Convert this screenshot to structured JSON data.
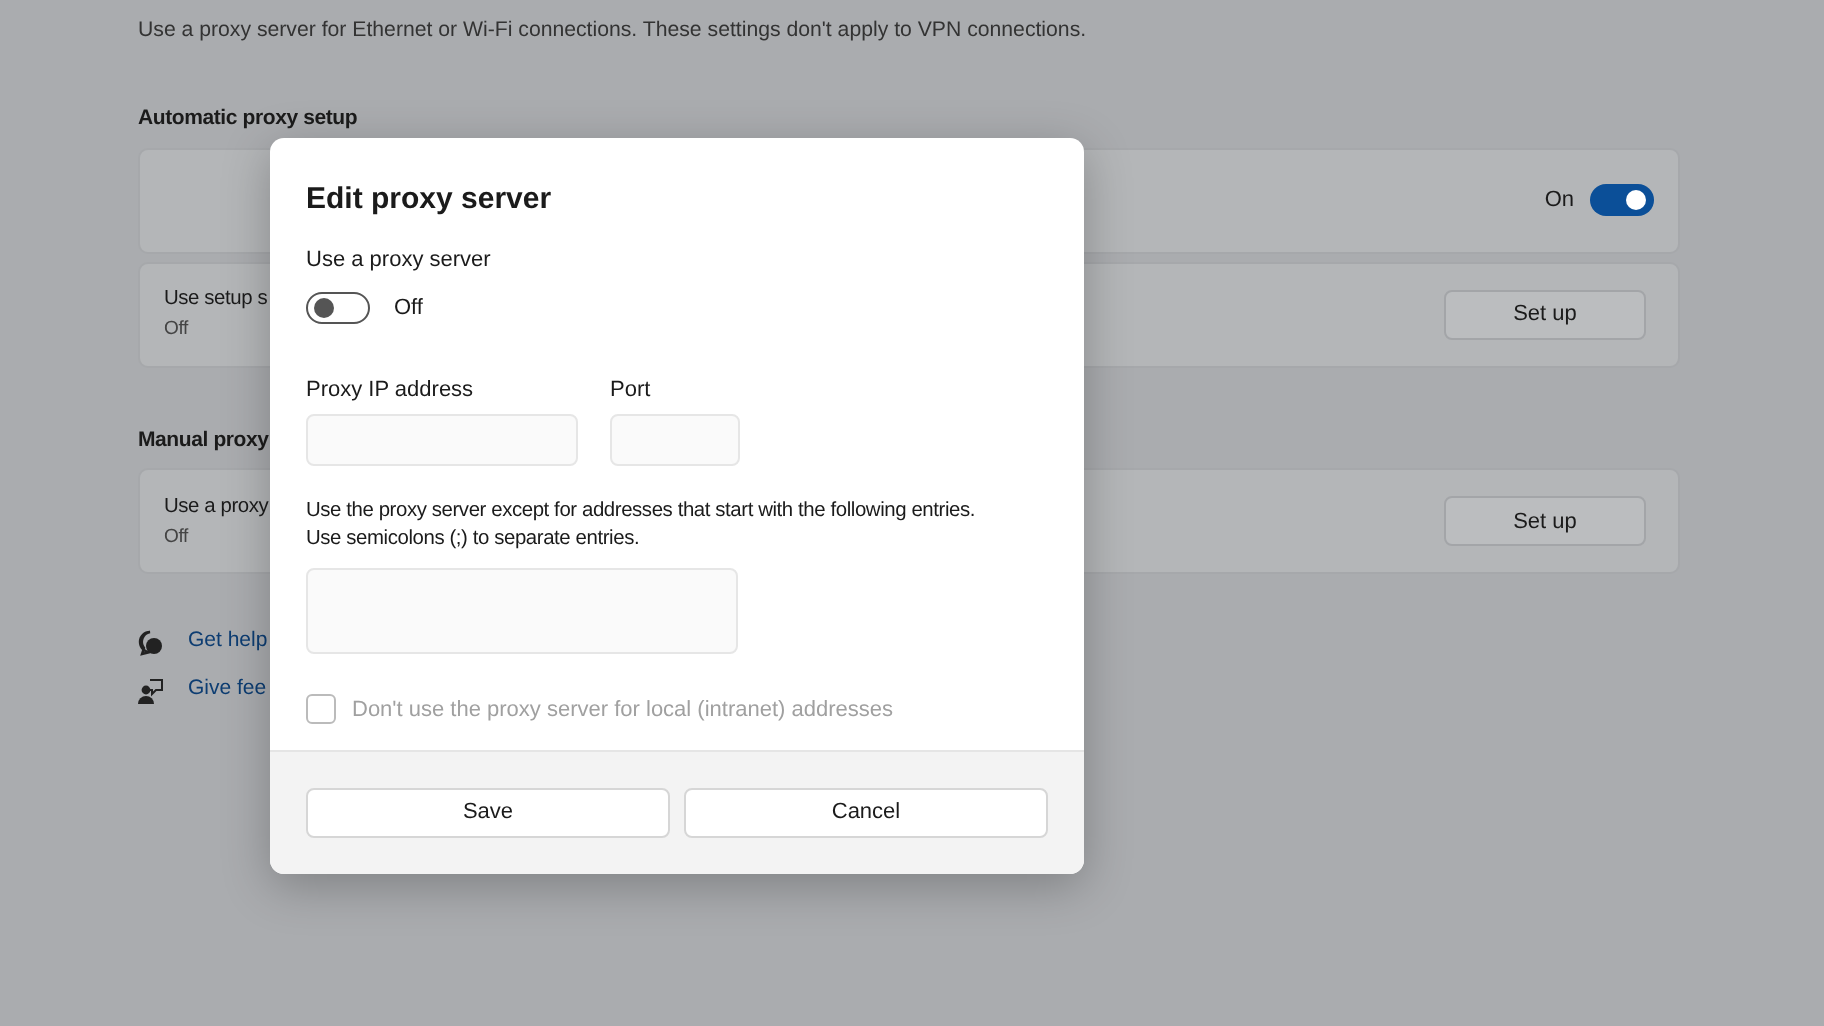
{
  "description": "Use a proxy server for Ethernet or Wi-Fi connections. These settings don't apply to VPN connections.",
  "automatic": {
    "heading": "Automatic proxy setup",
    "toggle": {
      "label": "On",
      "on": true
    },
    "setup_row": {
      "title": "Use setup s",
      "state": "Off",
      "button": "Set up"
    }
  },
  "manual": {
    "heading": "Manual proxy",
    "row": {
      "title": "Use a proxy",
      "state": "Off",
      "button": "Set up"
    }
  },
  "links": [
    {
      "kind": "help",
      "label": "Get help"
    },
    {
      "kind": "feedback",
      "label": "Give fee"
    }
  ],
  "dialog": {
    "title": "Edit proxy server",
    "use_proxy": {
      "label": "Use a proxy server",
      "state": "Off",
      "on": false
    },
    "ip_label": "Proxy IP address",
    "port_label": "Port",
    "exceptions_label": "Use the proxy server except for addresses that start with the following entries.\nUse semicolons (;) to separate entries.",
    "local_checkbox": {
      "label": "Don't use the proxy server for local (intranet) addresses",
      "checked": false,
      "disabled": true
    },
    "buttons": [
      "Save",
      "Cancel"
    ]
  }
}
